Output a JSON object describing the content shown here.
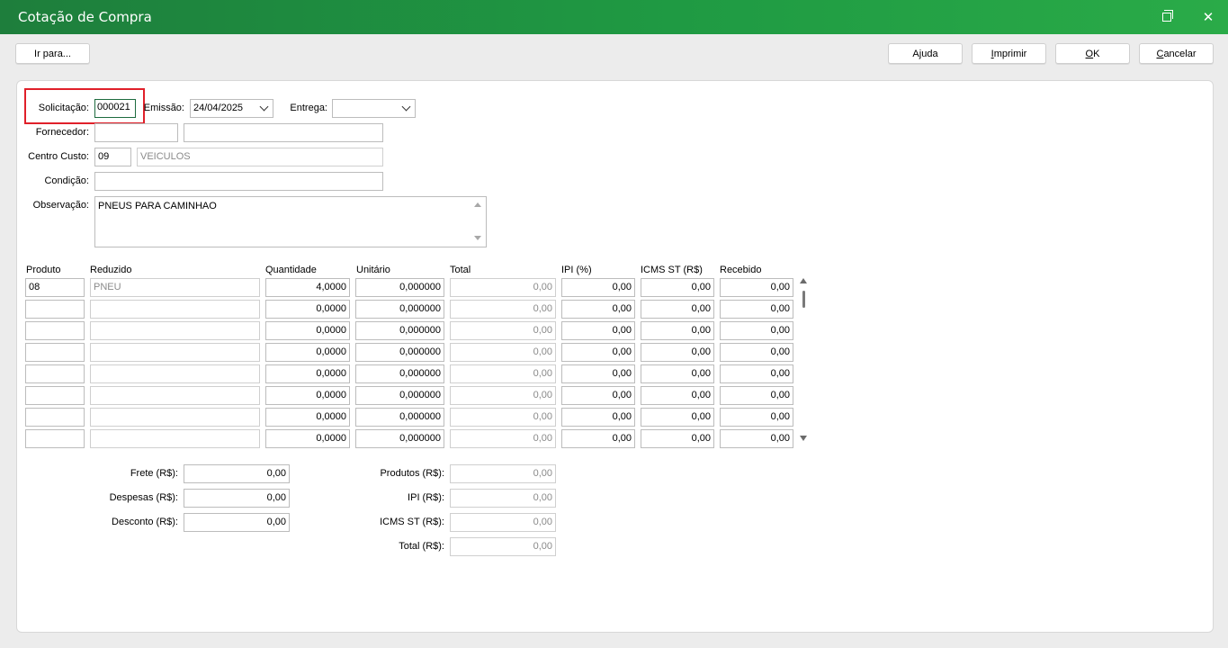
{
  "window": {
    "title": "Cotação de Compra",
    "restore_icon": "restore-icon",
    "close_glyph": "✕"
  },
  "toolbar": {
    "goto_label": "Ir para...",
    "help_label": "Ajuda",
    "print_label_pre": "",
    "print_label_u": "I",
    "print_label_post": "mprimir",
    "ok_label_u": "O",
    "ok_label_post": "K",
    "cancel_label_u": "C",
    "cancel_label_post": "ancelar"
  },
  "form": {
    "solicitacao_label": "Solicitação:",
    "solicitacao_value": "000021",
    "emissao_label": "Emissão:",
    "emissao_value": "24/04/2025",
    "entrega_label": "Entrega:",
    "entrega_value": "",
    "fornecedor_label": "Fornecedor:",
    "fornecedor_code": "",
    "fornecedor_name": "",
    "centro_label": "Centro Custo:",
    "centro_code": "09",
    "centro_name": "VEICULOS",
    "condicao_label": "Condição:",
    "condicao_value": "",
    "observacao_label": "Observação:",
    "observacao_value": "PNEUS PARA CAMINHAO"
  },
  "grid": {
    "headers": {
      "produto": "Produto",
      "reduzido": "Reduzido",
      "quantidade": "Quantidade",
      "unitario": "Unitário",
      "total": "Total",
      "ipi": "IPI (%)",
      "icms": "ICMS ST (R$)",
      "recebido": "Recebido"
    },
    "rows": [
      {
        "produto": "08",
        "reduzido": "PNEU",
        "quantidade": "4,0000",
        "unitario": "0,000000",
        "total": "0,00",
        "ipi": "0,00",
        "icms": "0,00",
        "recebido": "0,00"
      },
      {
        "produto": "",
        "reduzido": "",
        "quantidade": "0,0000",
        "unitario": "0,000000",
        "total": "0,00",
        "ipi": "0,00",
        "icms": "0,00",
        "recebido": "0,00"
      },
      {
        "produto": "",
        "reduzido": "",
        "quantidade": "0,0000",
        "unitario": "0,000000",
        "total": "0,00",
        "ipi": "0,00",
        "icms": "0,00",
        "recebido": "0,00"
      },
      {
        "produto": "",
        "reduzido": "",
        "quantidade": "0,0000",
        "unitario": "0,000000",
        "total": "0,00",
        "ipi": "0,00",
        "icms": "0,00",
        "recebido": "0,00"
      },
      {
        "produto": "",
        "reduzido": "",
        "quantidade": "0,0000",
        "unitario": "0,000000",
        "total": "0,00",
        "ipi": "0,00",
        "icms": "0,00",
        "recebido": "0,00"
      },
      {
        "produto": "",
        "reduzido": "",
        "quantidade": "0,0000",
        "unitario": "0,000000",
        "total": "0,00",
        "ipi": "0,00",
        "icms": "0,00",
        "recebido": "0,00"
      },
      {
        "produto": "",
        "reduzido": "",
        "quantidade": "0,0000",
        "unitario": "0,000000",
        "total": "0,00",
        "ipi": "0,00",
        "icms": "0,00",
        "recebido": "0,00"
      },
      {
        "produto": "",
        "reduzido": "",
        "quantidade": "0,0000",
        "unitario": "0,000000",
        "total": "0,00",
        "ipi": "0,00",
        "icms": "0,00",
        "recebido": "0,00"
      }
    ]
  },
  "totals": {
    "frete_label": "Frete (R$):",
    "frete_value": "0,00",
    "despesas_label": "Despesas (R$):",
    "despesas_value": "0,00",
    "desconto_label": "Desconto (R$):",
    "desconto_value": "0,00",
    "produtos_label": "Produtos (R$):",
    "produtos_value": "0,00",
    "ipi_label": "IPI (R$):",
    "ipi_value": "0,00",
    "icms_label": "ICMS ST (R$):",
    "icms_value": "0,00",
    "total_label": "Total (R$):",
    "total_value": "0,00"
  }
}
